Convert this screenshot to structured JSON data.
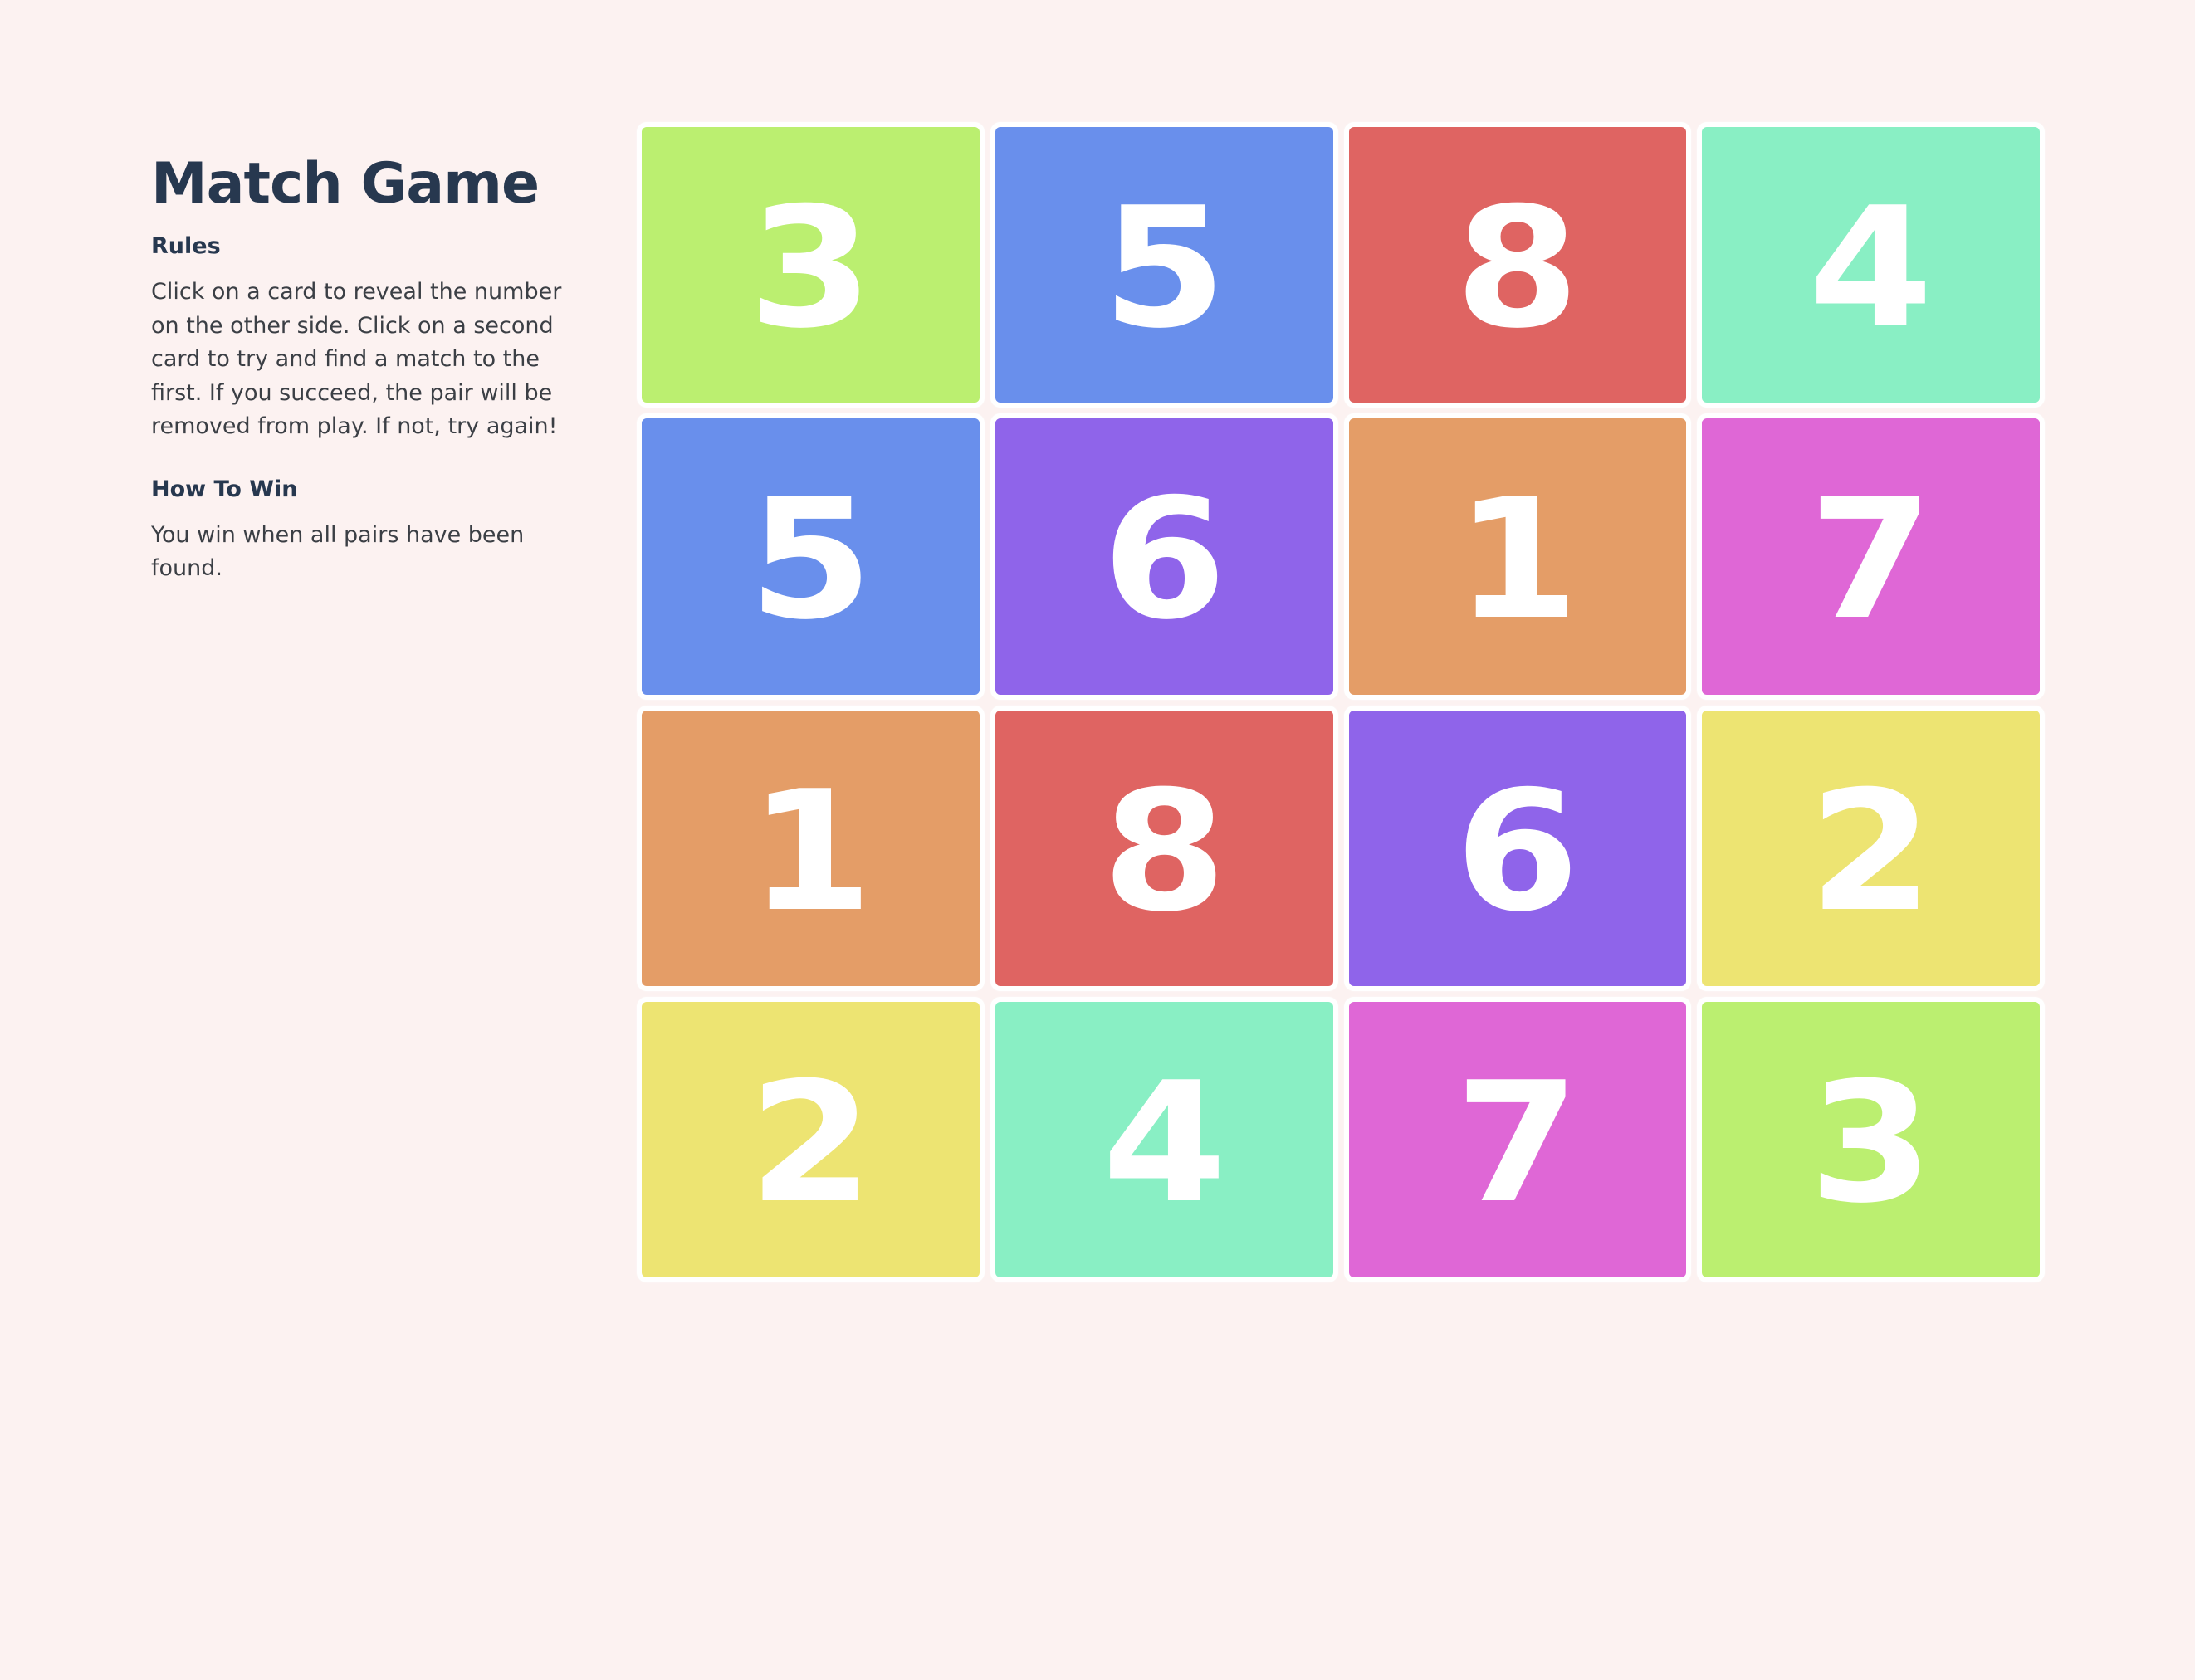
{
  "sidebar": {
    "title": "Match Game",
    "rules_heading": "Rules",
    "rules_text": "Click on a card to reveal the number on the other side. Click on a second card to try and find a match to the first. If you succeed, the pair will be removed from play. If not, try again!",
    "win_heading": "How To Win",
    "win_text": "You win when all pairs have been found."
  },
  "colors": {
    "background": "#fcf2f1",
    "heading": "#27384f",
    "body_text": "#3b3f45",
    "card_1": "#e49d67",
    "card_2": "#ede472",
    "card_3": "#bbef70",
    "card_4": "#89efc4",
    "card_5": "#698fec",
    "card_6": "#8f64ea",
    "card_7": "#df67d6",
    "card_8": "#df6462"
  },
  "board": {
    "cards": [
      {
        "value": "3",
        "color": "#bbef70"
      },
      {
        "value": "5",
        "color": "#698fec"
      },
      {
        "value": "8",
        "color": "#df6462"
      },
      {
        "value": "4",
        "color": "#89efc4"
      },
      {
        "value": "5",
        "color": "#698fec"
      },
      {
        "value": "6",
        "color": "#8f64ea"
      },
      {
        "value": "1",
        "color": "#e49d67"
      },
      {
        "value": "7",
        "color": "#df67d6"
      },
      {
        "value": "1",
        "color": "#e49d67"
      },
      {
        "value": "8",
        "color": "#df6462"
      },
      {
        "value": "6",
        "color": "#8f64ea"
      },
      {
        "value": "2",
        "color": "#ede472"
      },
      {
        "value": "2",
        "color": "#ede472"
      },
      {
        "value": "4",
        "color": "#89efc4"
      },
      {
        "value": "7",
        "color": "#df67d6"
      },
      {
        "value": "3",
        "color": "#bbef70"
      }
    ]
  }
}
